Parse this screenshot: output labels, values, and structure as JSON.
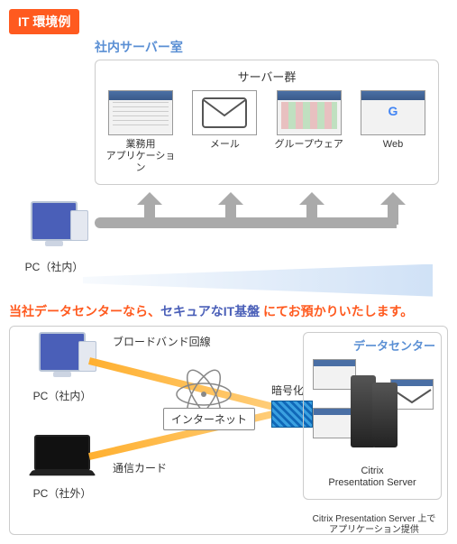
{
  "badge": "IT 環境例",
  "top": {
    "section_title": "社内サーバー室",
    "group_title": "サーバー群",
    "items": [
      {
        "label": "業務用\nアプリケーション"
      },
      {
        "label": "メール"
      },
      {
        "label": "グループウェア"
      },
      {
        "label": "Web"
      }
    ],
    "pc_label": "PC（社内）"
  },
  "headline": {
    "part1": "当社データセンターなら、",
    "highlight": "セキュアなIT基盤",
    "part2": " にてお預かりいたします。"
  },
  "bottom": {
    "pc_in_label": "PC（社内）",
    "pc_out_label": "PC（社外）",
    "broadband": "ブロードバンド回線",
    "carrier": "通信カード",
    "internet": "インターネット",
    "encryption": "暗号化",
    "dc_title": "データセンター",
    "dc_server": "Citrix\nPresentation Server",
    "footnote": "Citrix Presentation Server 上で\nアプリケーション提供"
  }
}
